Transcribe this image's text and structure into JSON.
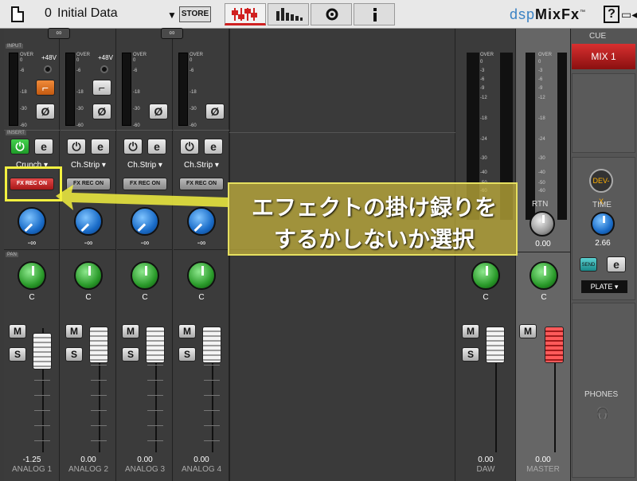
{
  "topbar": {
    "preset_number": "0",
    "preset_name": "Initial Data",
    "store_label": "STORE",
    "brand_prefix": "dsp",
    "brand_name": "MixFx",
    "brand_tm": "™",
    "help_label": "?"
  },
  "strips": [
    {
      "section": "INPUT",
      "phantom": "+48V",
      "insert_label": "INSERT",
      "insert_effect": "Crunch",
      "fx_rec": "FX REC ON",
      "fx_rec_on": true,
      "send_value": "-∞",
      "pan_label": "PAN",
      "pan_value": "C",
      "mute": "M",
      "solo": "S",
      "fader_value": "-1.25",
      "name": "ANALOG 1"
    },
    {
      "section": "",
      "phantom": "+48V",
      "insert_label": "",
      "insert_effect": "Ch.Strip",
      "fx_rec": "FX REC ON",
      "fx_rec_on": false,
      "send_value": "-∞",
      "pan_label": "",
      "pan_value": "C",
      "mute": "M",
      "solo": "S",
      "fader_value": "0.00",
      "name": "ANALOG 2"
    },
    {
      "section": "",
      "phantom": "",
      "insert_label": "",
      "insert_effect": "Ch.Strip",
      "fx_rec": "FX REC ON",
      "fx_rec_on": false,
      "send_value": "-∞",
      "pan_label": "",
      "pan_value": "C",
      "mute": "M",
      "solo": "S",
      "fader_value": "0.00",
      "name": "ANALOG 3"
    },
    {
      "section": "",
      "phantom": "",
      "insert_label": "",
      "insert_effect": "Ch.Strip",
      "fx_rec": "FX REC ON",
      "fx_rec_on": false,
      "send_value": "-∞",
      "pan_label": "",
      "pan_value": "C",
      "mute": "M",
      "solo": "S",
      "fader_value": "0.00",
      "name": "ANALOG 4"
    }
  ],
  "meter_ticks": [
    "OVER",
    "0",
    "-6",
    "-18",
    "-30",
    "-60"
  ],
  "daw": {
    "pan_value": "C",
    "mute": "M",
    "solo": "S",
    "fader_value": "0.00",
    "name": "DAW",
    "ticks": [
      "OVER",
      "0",
      "-3",
      "-6",
      "-9",
      "-12",
      "-18",
      "-24",
      "-30",
      "-40",
      "-50",
      "-60"
    ]
  },
  "master": {
    "rtn_label": "RTN",
    "rtn_value": "0.00",
    "pan_value": "C",
    "mute": "M",
    "fader_value": "0.00",
    "name": "MASTER",
    "ticks": [
      "OVER",
      "0",
      "-3",
      "-6",
      "-9",
      "-12",
      "-18",
      "-24",
      "-30",
      "-40",
      "-50",
      "-60"
    ]
  },
  "cue": {
    "label": "CUE",
    "mix_button": "MIX 1",
    "devx": "DEV-X",
    "time_label": "TIME",
    "time_value": "2.66",
    "send_label": "SEND",
    "reverb_type": "PLATE",
    "phones_label": "PHONES"
  },
  "annotation": {
    "line1": "エフェクトの掛け録りを",
    "line2": "するかしないか選択"
  },
  "colors": {
    "accent_red": "#d02020",
    "brand_blue": "#3a82c4",
    "knob_blue": "#1a6cc8",
    "knob_green": "#2a9a2a",
    "highlight_yellow": "#f2f040"
  }
}
